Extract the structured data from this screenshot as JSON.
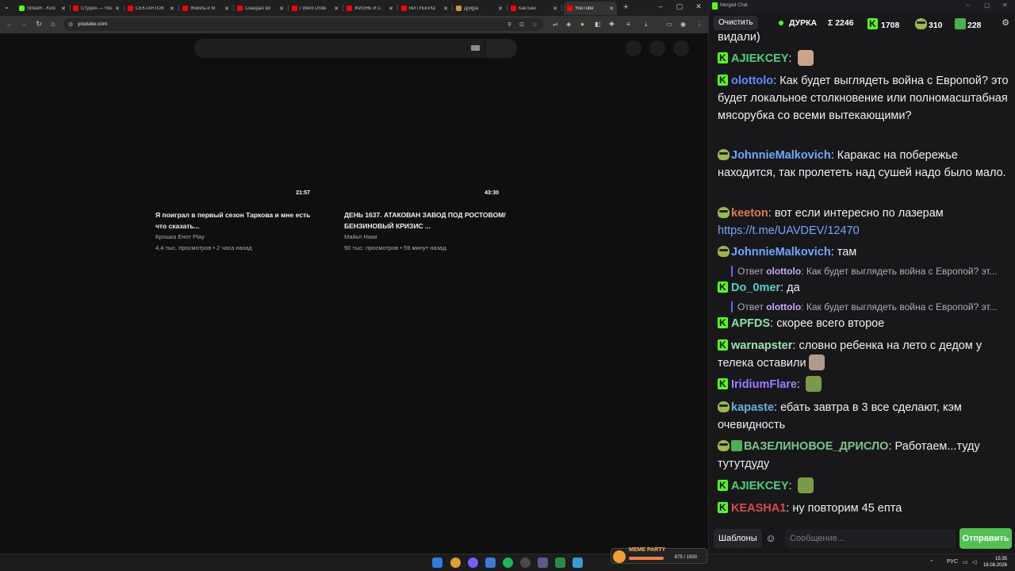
{
  "browser": {
    "tabs": [
      {
        "label": "Stream - Kick",
        "color": "#53fc18",
        "active": false
      },
      {
        "label": "Студия — YouTube",
        "color": "#ff0000",
        "active": false
      },
      {
        "label": "СЕКТАНТОВ",
        "color": "#ff0000",
        "active": false
      },
      {
        "label": "Жмиль и М",
        "color": "#ff0000",
        "active": false
      },
      {
        "label": "Скандал во",
        "color": "#ff0000",
        "active": false
      },
      {
        "label": "I Went Unde",
        "color": "#ff0000",
        "active": false
      },
      {
        "label": "ЖИЗНЬ И С",
        "color": "#ff0000",
        "active": false
      },
      {
        "label": "ВИТУБЕРШ",
        "color": "#ff0000",
        "active": false
      },
      {
        "label": "Д[м]ра",
        "color": "#c49a3a",
        "active": false
      },
      {
        "label": "Как Бен",
        "color": "#ff0000",
        "active": false
      },
      {
        "label": "YouTube",
        "color": "#ff0000",
        "active": true
      }
    ],
    "new_tab": "+",
    "url": "youtube.com"
  },
  "youtube": {
    "videos": [
      {
        "duration": "21:57",
        "title": "Я поиграл в первый сезон Таркова и мне есть что сказать...",
        "channel": "Крошка Енот Play",
        "views": "4,4 тыс. просмотров",
        "age": "2 часа назад"
      },
      {
        "duration": "43:30",
        "title": "ДЕНЬ 1637. АТАКОВАН ЗАВОД ПОД РОСТОВОМ/ БЕНЗИНОВЫЙ КРИЗИС ...",
        "channel": "Майкл Наки",
        "views": "90 тыс. просмотров",
        "age": "59 минут назад"
      }
    ]
  },
  "chat": {
    "window_title": "Merged Chat",
    "clear_label": "Очистить",
    "channel": "ДУРКА",
    "stats": [
      {
        "icon": "sigma",
        "value": "Σ 2246"
      },
      {
        "icon": "kick-logo",
        "value": "1708"
      },
      {
        "icon": "pepe",
        "value": "310"
      },
      {
        "icon": "frog",
        "value": "228"
      }
    ],
    "messages": [
      {
        "badges": [],
        "user": "",
        "user_color": "#efeff1",
        "text": "видали)"
      },
      {
        "badges": [
          "kick"
        ],
        "user": "AJIEKCEY",
        "user_color": "#4ed17b",
        "text": "",
        "emote_color": "#c9a489"
      },
      {
        "badges": [
          "kick"
        ],
        "user": "olottolo",
        "user_color": "#5b8cff",
        "text": "Как будет выглядеть война с Европой? это будет локальное столкновение или полномасштабная мясорубка со всеми вытекающими?"
      },
      {
        "badges": [
          "pepe"
        ],
        "user": "JohnnieMalkovich",
        "user_color": "#6fa8ff",
        "text": "Каракас на побережье находится, так пролететь над сушей надо было мало."
      },
      {
        "badges": [
          "pepe"
        ],
        "user": "keeton",
        "user_color": "#e07a4a",
        "text": "вот если интересно по лазерам",
        "link": "https://t.me/UAVDEV/12470"
      },
      {
        "badges": [
          "pepe"
        ],
        "user": "JohnnieMalkovich",
        "user_color": "#6fa8ff",
        "text": "там",
        "reply": {
          "label": "Ответ",
          "user": "olottolo",
          "text": "Как будет выглядеть война с Европой? эт..."
        }
      },
      {
        "badges": [
          "kick"
        ],
        "user": "Do_0mer",
        "user_color": "#4ed1c9",
        "text": "да",
        "reply": {
          "label": "Ответ",
          "user": "olottolo",
          "text": "Как будет выглядеть война с Европой? эт..."
        }
      },
      {
        "badges": [
          "kick"
        ],
        "user": "APFDS",
        "user_color": "#8ee0a6",
        "text": "скорее всего второе"
      },
      {
        "badges": [
          "kick"
        ],
        "user": "warnapster",
        "user_color": "#9ee0b2",
        "text": "словно ребенка на лето с дедом у телека оставили",
        "emote_color": "#b09a8a"
      },
      {
        "badges": [
          "kick"
        ],
        "user": "IridiumFlare",
        "user_color": "#a07aff",
        "text": "",
        "emote_color": "#7a9a4a"
      },
      {
        "badges": [
          "pepe"
        ],
        "user": "kapaste",
        "user_color": "#6ab0e0",
        "text": "ебать завтра в 3 все сделают, кэм очевидность"
      },
      {
        "badges": [
          "pepe",
          "pencil"
        ],
        "user": "ВАЗЕЛИНОВОЕ_ДРИСЛО",
        "user_color": "#7ac48a",
        "text": "Работаем...туду тутутдуду"
      },
      {
        "badges": [
          "kick"
        ],
        "user": "AJIEKCEY",
        "user_color": "#4ed17b",
        "text": "",
        "emote_color": "#7a9a4a"
      },
      {
        "badges": [
          "kick"
        ],
        "user": "KEASHA1",
        "user_color": "#e04848",
        "text": "ну повторим 45 епта"
      }
    ],
    "templates_label": "Шаблоны",
    "input_placeholder": "Сообщение...",
    "send_label": "Отправить"
  },
  "taskbar": {
    "meme_party_label": "MEME PARTY",
    "meme_party_count": "875 / 1500",
    "lang": "РУС",
    "time": "15:35",
    "date": "18.08.2026"
  }
}
